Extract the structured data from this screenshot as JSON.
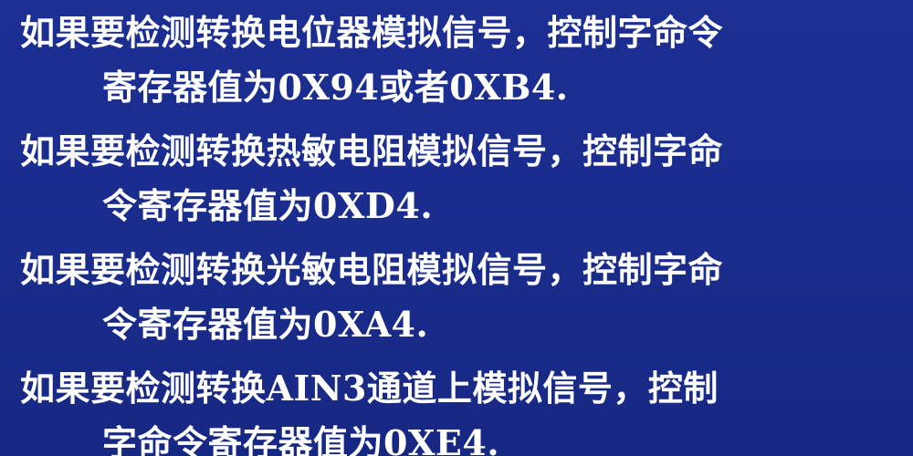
{
  "slide": {
    "paragraphs": [
      {
        "line1": "如果要检测转换电位器模拟信号，控制字命令",
        "line2": "寄存器值为0X94或者0XB4."
      },
      {
        "line1": "如果要检测转换热敏电阻模拟信号，控制字命",
        "line2": "令寄存器值为0XD4."
      },
      {
        "line1": "如果要检测转换光敏电阻模拟信号，控制字命",
        "line2": "令寄存器值为0XA4."
      },
      {
        "line1": "如果要检测转换AIN3通道上模拟信号，控制",
        "line2": "字命令寄存器值为0XE4."
      }
    ]
  },
  "colors": {
    "background": "#1a2c8c",
    "text": "#ffffff"
  }
}
